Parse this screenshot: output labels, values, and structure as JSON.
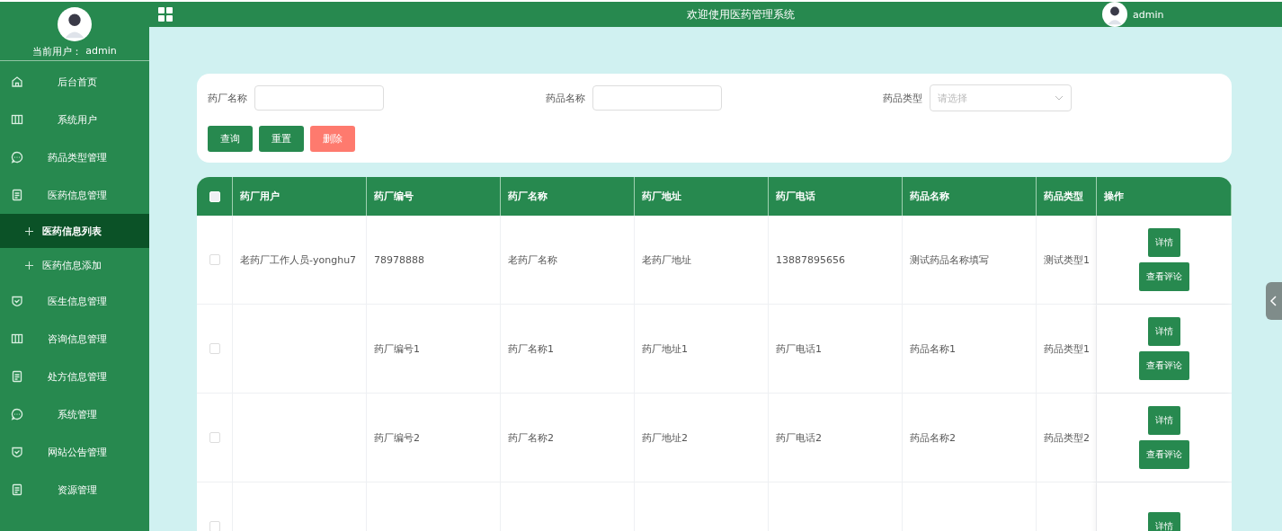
{
  "sidebar": {
    "current_user_label": "当前用户：",
    "current_user": "admin",
    "items": [
      {
        "label": "后台首页",
        "kind": "home"
      },
      {
        "label": "系统用户",
        "kind": "columns"
      },
      {
        "label": "药品类型管理",
        "kind": "chat"
      },
      {
        "label": "医药信息管理",
        "kind": "doc",
        "children": [
          {
            "label": "医药信息列表",
            "selected": true
          },
          {
            "label": "医药信息添加",
            "selected": false
          }
        ]
      },
      {
        "label": "医生信息管理",
        "kind": "shield"
      },
      {
        "label": "咨询信息管理",
        "kind": "columns"
      },
      {
        "label": "处方信息管理",
        "kind": "doc"
      },
      {
        "label": "系统管理",
        "kind": "chat"
      },
      {
        "label": "网站公告管理",
        "kind": "shield"
      },
      {
        "label": "资源管理",
        "kind": "doc"
      }
    ]
  },
  "header": {
    "title": "欢迎使用医药管理系统",
    "user": "admin"
  },
  "search": {
    "fields": [
      {
        "kind": "input",
        "label": "药厂名称"
      },
      {
        "kind": "input",
        "label": "药品名称"
      },
      {
        "kind": "select",
        "label": "药品类型",
        "placeholder": "请选择"
      }
    ],
    "buttons": [
      {
        "label": "查询",
        "kind": "primary"
      },
      {
        "label": "重置",
        "kind": "primary"
      },
      {
        "label": "删除",
        "kind": "danger"
      }
    ]
  },
  "table": {
    "select_all": false,
    "columns": [
      "药厂用户",
      "药厂编号",
      "药厂名称",
      "药厂地址",
      "药厂电话",
      "药品名称",
      "药品类型",
      "操作"
    ],
    "rows": [
      {
        "checked": false,
        "cells": [
          "老药厂工作人员-yonghu7",
          "78978888",
          "老药厂名称",
          "老药厂地址",
          "13887895656",
          "测试药品名称填写",
          "测试类型1"
        ],
        "actions": [
          "详情",
          "查看评论"
        ]
      },
      {
        "checked": false,
        "cells": [
          "",
          "药厂编号1",
          "药厂名称1",
          "药厂地址1",
          "药厂电话1",
          "药品名称1",
          "药品类型1"
        ],
        "actions": [
          "详情",
          "查看评论"
        ]
      },
      {
        "checked": false,
        "cells": [
          "",
          "药厂编号2",
          "药厂名称2",
          "药厂地址2",
          "药厂电话2",
          "药品名称2",
          "药品类型2"
        ],
        "actions": [
          "详情",
          "查看评论"
        ]
      },
      {
        "checked": false,
        "cells": [
          "",
          "",
          "",
          "",
          "",
          "",
          ""
        ],
        "actions": [
          "详情"
        ]
      }
    ]
  }
}
